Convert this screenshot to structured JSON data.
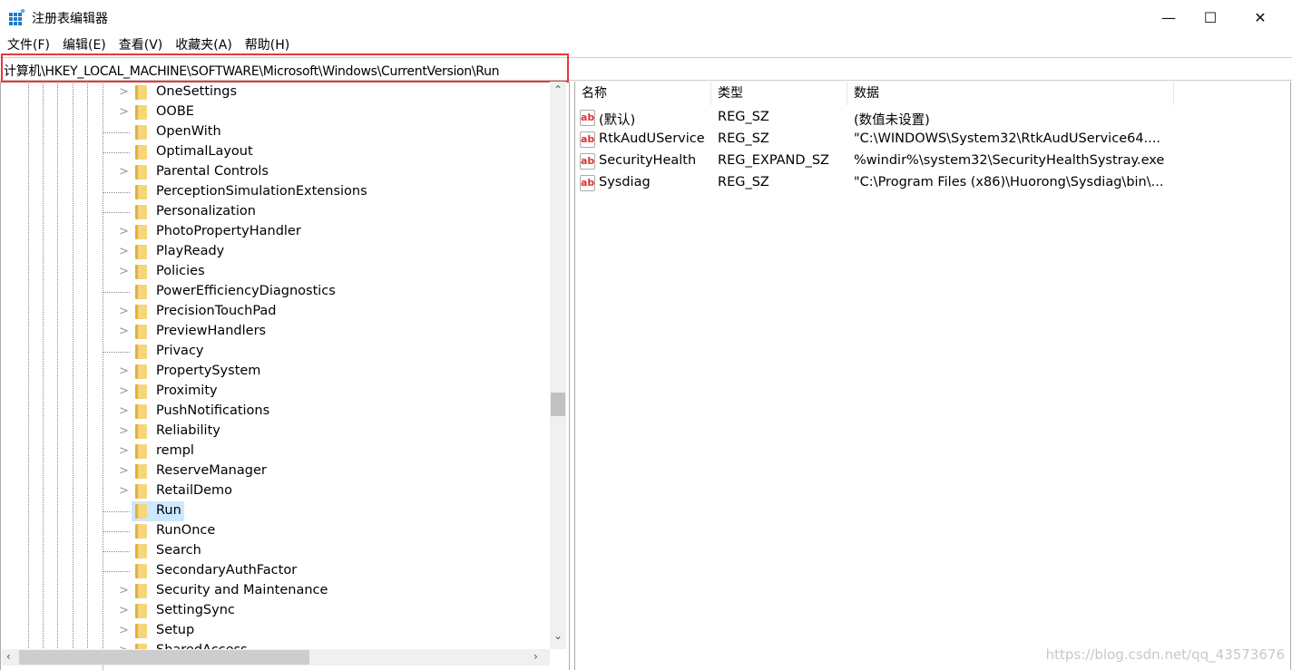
{
  "window": {
    "title": "注册表编辑器",
    "minimize": "—",
    "maximize": "☐",
    "close": "✕"
  },
  "menu": [
    "文件(F)",
    "编辑(E)",
    "查看(V)",
    "收藏夹(A)",
    "帮助(H)"
  ],
  "address": "计算机\\HKEY_LOCAL_MACHINE\\SOFTWARE\\Microsoft\\Windows\\CurrentVersion\\Run",
  "tree": [
    {
      "label": "OneSettings",
      "expandable": true
    },
    {
      "label": "OOBE",
      "expandable": true
    },
    {
      "label": "OpenWith",
      "expandable": false
    },
    {
      "label": "OptimalLayout",
      "expandable": false
    },
    {
      "label": "Parental Controls",
      "expandable": true
    },
    {
      "label": "PerceptionSimulationExtensions",
      "expandable": false
    },
    {
      "label": "Personalization",
      "expandable": false
    },
    {
      "label": "PhotoPropertyHandler",
      "expandable": true
    },
    {
      "label": "PlayReady",
      "expandable": true
    },
    {
      "label": "Policies",
      "expandable": true
    },
    {
      "label": "PowerEfficiencyDiagnostics",
      "expandable": false
    },
    {
      "label": "PrecisionTouchPad",
      "expandable": true
    },
    {
      "label": "PreviewHandlers",
      "expandable": true
    },
    {
      "label": "Privacy",
      "expandable": false
    },
    {
      "label": "PropertySystem",
      "expandable": true
    },
    {
      "label": "Proximity",
      "expandable": true
    },
    {
      "label": "PushNotifications",
      "expandable": true
    },
    {
      "label": "Reliability",
      "expandable": true
    },
    {
      "label": "rempl",
      "expandable": true
    },
    {
      "label": "ReserveManager",
      "expandable": true
    },
    {
      "label": "RetailDemo",
      "expandable": true
    },
    {
      "label": "Run",
      "expandable": false,
      "selected": true
    },
    {
      "label": "RunOnce",
      "expandable": false
    },
    {
      "label": "Search",
      "expandable": false
    },
    {
      "label": "SecondaryAuthFactor",
      "expandable": false
    },
    {
      "label": "Security and Maintenance",
      "expandable": true
    },
    {
      "label": "SettingSync",
      "expandable": true
    },
    {
      "label": "Setup",
      "expandable": true
    },
    {
      "label": "SharedAccess",
      "expandable": true
    }
  ],
  "values": {
    "columns": [
      "名称",
      "类型",
      "数据"
    ],
    "rows": [
      {
        "name": "(默认)",
        "type": "REG_SZ",
        "data": "(数值未设置)"
      },
      {
        "name": "RtkAudUService",
        "type": "REG_SZ",
        "data": "\"C:\\WINDOWS\\System32\\RtkAudUService64...."
      },
      {
        "name": "SecurityHealth",
        "type": "REG_EXPAND_SZ",
        "data": "%windir%\\system32\\SecurityHealthSystray.exe"
      },
      {
        "name": "Sysdiag",
        "type": "REG_SZ",
        "data": "\"C:\\Program Files (x86)\\Huorong\\Sysdiag\\bin\\..."
      }
    ],
    "icon": "ab"
  },
  "watermark": "https://blog.csdn.net/qq_43573676",
  "colors": {
    "highlight": "#cce8ff",
    "address_outline": "#e8383d",
    "value_icon": "#dd3333"
  }
}
